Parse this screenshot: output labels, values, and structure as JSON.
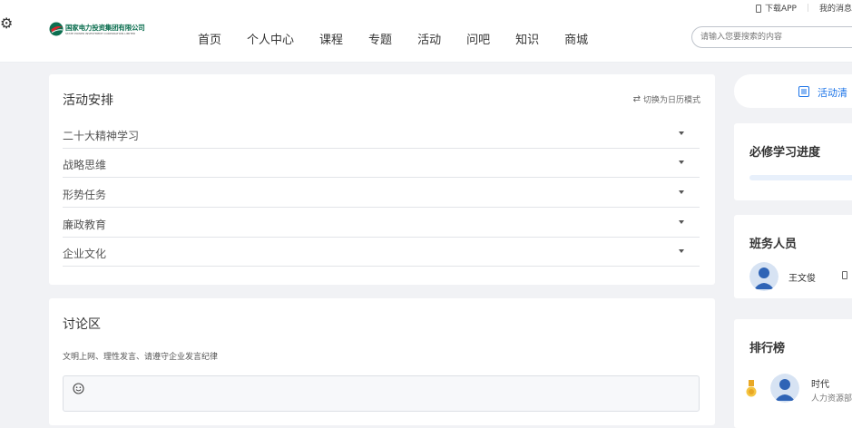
{
  "topbar": {
    "download_app": "下载APP",
    "messages": "我的消息"
  },
  "header": {
    "logo_text": "国家电力投资集团有限公司",
    "logo_sub": "STATE POWER INVESTMENT CORPORATION LIMITED",
    "nav": [
      "首页",
      "个人中心",
      "课程",
      "专题",
      "活动",
      "问吧",
      "知识",
      "商城"
    ],
    "search_placeholder": "请输入您要搜索的内容"
  },
  "schedule": {
    "title": "活动安排",
    "switch_mode": "切换为日历模式",
    "items": [
      "二十大精神学习",
      "战略思维",
      "形势任务",
      "廉政教育",
      "企业文化"
    ]
  },
  "discussion": {
    "title": "讨论区",
    "hint": "文明上网、理性发言、请遵守企业发言纪律",
    "emoji_icon": "smiley-icon"
  },
  "sidebar": {
    "activity_list": "活动清",
    "progress_title": "必修学习进度",
    "progress_value": 0,
    "staff_title": "班务人员",
    "staff_name": "王文俊",
    "rank_title": "排行榜",
    "rank_name": "时代",
    "rank_sub": "人力资源部"
  },
  "colors": {
    "accent": "#1a73e8",
    "progress_track": "#e8f0fb",
    "logo_green": "#0b6e4f",
    "logo_red": "#d7262c"
  }
}
